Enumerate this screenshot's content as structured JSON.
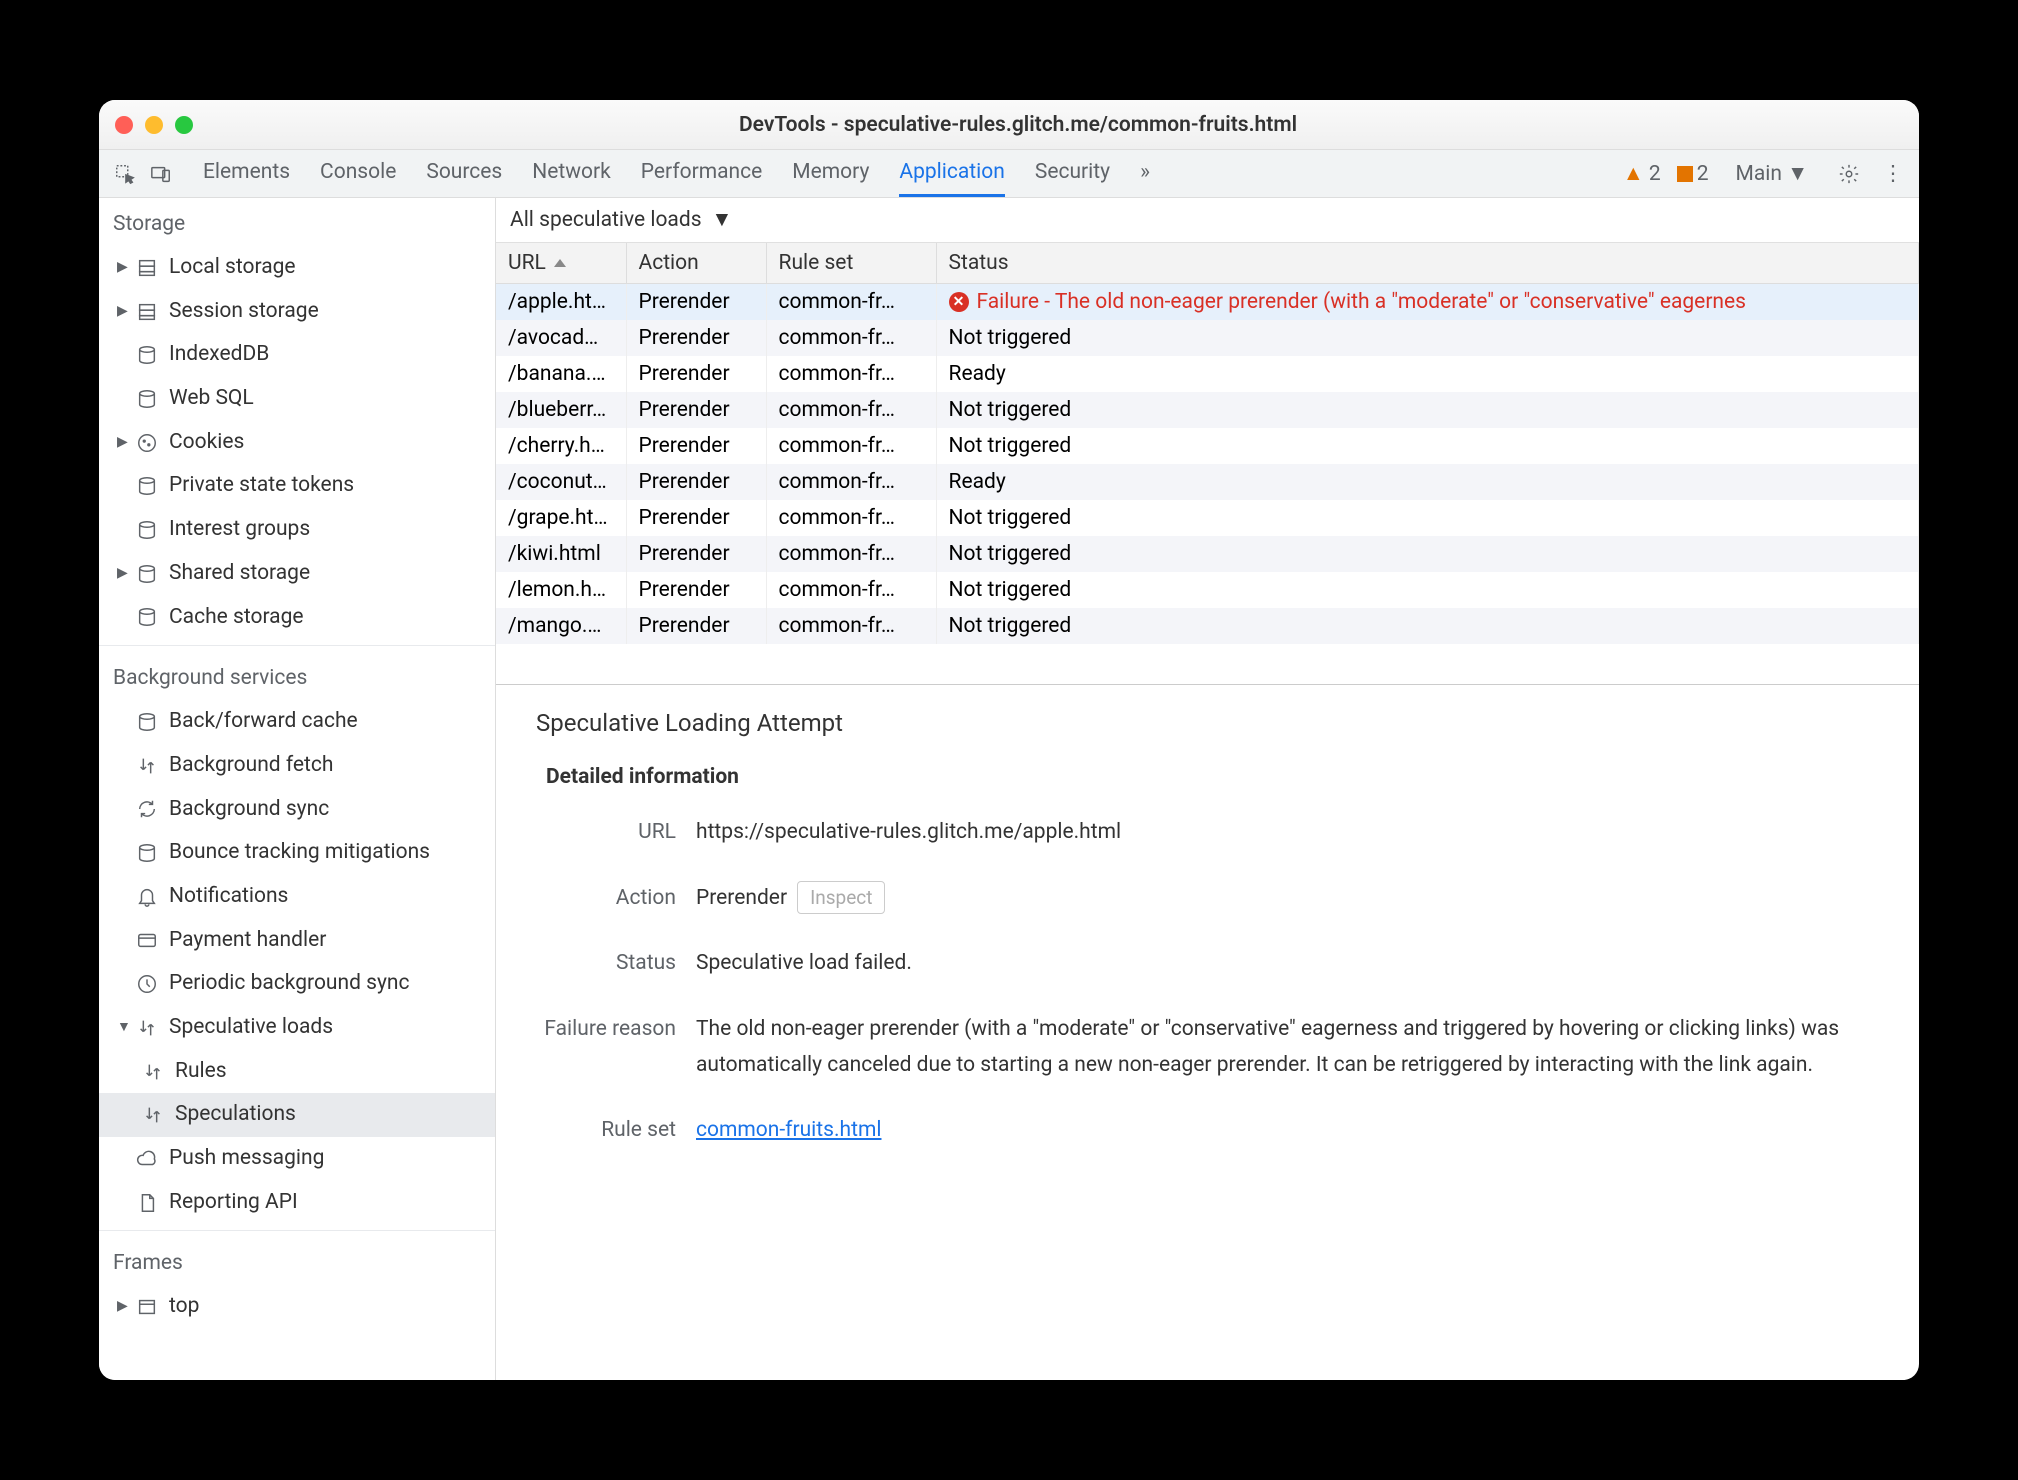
{
  "window_title": "DevTools - speculative-rules.glitch.me/common-fruits.html",
  "tabs": [
    "Elements",
    "Console",
    "Sources",
    "Network",
    "Performance",
    "Memory",
    "Application",
    "Security"
  ],
  "active_tab": "Application",
  "warnings": "2",
  "issues": "2",
  "main_label": "Main",
  "sidebar": {
    "storage": {
      "title": "Storage",
      "items": [
        "Local storage",
        "Session storage",
        "IndexedDB",
        "Web SQL",
        "Cookies",
        "Private state tokens",
        "Interest groups",
        "Shared storage",
        "Cache storage"
      ]
    },
    "bg": {
      "title": "Background services",
      "items": [
        "Back/forward cache",
        "Background fetch",
        "Background sync",
        "Bounce tracking mitigations",
        "Notifications",
        "Payment handler",
        "Periodic background sync",
        "Speculative loads",
        "Rules",
        "Speculations",
        "Push messaging",
        "Reporting API"
      ]
    },
    "frames": {
      "title": "Frames",
      "top": "top"
    }
  },
  "filter": "All speculative loads",
  "table": {
    "headers": [
      "URL",
      "Action",
      "Rule set",
      "Status"
    ],
    "rows": [
      {
        "url": "/apple.html",
        "action": "Prerender",
        "ruleset": "common-fr…",
        "status": "Failure - The old non-eager prerender (with a \"moderate\" or \"conservative\" eagernes",
        "error": true
      },
      {
        "url": "/avocad…",
        "action": "Prerender",
        "ruleset": "common-fr…",
        "status": "Not triggered"
      },
      {
        "url": "/banana.…",
        "action": "Prerender",
        "ruleset": "common-fr…",
        "status": "Ready"
      },
      {
        "url": "/blueberr…",
        "action": "Prerender",
        "ruleset": "common-fr…",
        "status": "Not triggered"
      },
      {
        "url": "/cherry.h…",
        "action": "Prerender",
        "ruleset": "common-fr…",
        "status": "Not triggered"
      },
      {
        "url": "/coconut…",
        "action": "Prerender",
        "ruleset": "common-fr…",
        "status": "Ready"
      },
      {
        "url": "/grape.html",
        "action": "Prerender",
        "ruleset": "common-fr…",
        "status": "Not triggered"
      },
      {
        "url": "/kiwi.html",
        "action": "Prerender",
        "ruleset": "common-fr…",
        "status": "Not triggered"
      },
      {
        "url": "/lemon.h…",
        "action": "Prerender",
        "ruleset": "common-fr…",
        "status": "Not triggered"
      },
      {
        "url": "/mango.…",
        "action": "Prerender",
        "ruleset": "common-fr…",
        "status": "Not triggered"
      }
    ]
  },
  "detail": {
    "heading": "Speculative Loading Attempt",
    "section": "Detailed information",
    "url_k": "URL",
    "url_v": "https://speculative-rules.glitch.me/apple.html",
    "action_k": "Action",
    "action_v": "Prerender",
    "inspect": "Inspect",
    "status_k": "Status",
    "status_v": "Speculative load failed.",
    "reason_k": "Failure reason",
    "reason_v": "The old non-eager prerender (with a \"moderate\" or \"conservative\" eagerness and triggered by hovering or clicking links) was automatically canceled due to starting a new non-eager prerender. It can be retriggered by interacting with the link again.",
    "ruleset_k": "Rule set",
    "ruleset_v": "common-fruits.html"
  }
}
